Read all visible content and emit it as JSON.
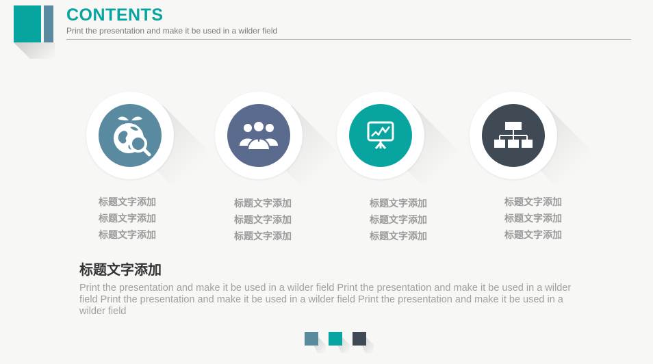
{
  "header": {
    "title": "CONTENTS",
    "subtitle": "Print the presentation and make it be used in a wilder field"
  },
  "colors": {
    "teal": "#08a5a0",
    "slate_blue": "#5a8aa0",
    "indigo": "#5a6b8e",
    "charcoal": "#3f4a55"
  },
  "items": [
    {
      "icon": "globe-search-icon",
      "lines": [
        "标题文字添加",
        "标题文字添加",
        "标题文字添加"
      ]
    },
    {
      "icon": "team-icon",
      "lines": [
        "标题文字添加",
        "标题文字添加",
        "标题文字添加"
      ]
    },
    {
      "icon": "presentation-chart-icon",
      "lines": [
        "标题文字添加",
        "标题文字添加",
        "标题文字添加"
      ]
    },
    {
      "icon": "org-chart-icon",
      "lines": [
        "标题文字添加",
        "标题文字添加",
        "标题文字添加"
      ]
    }
  ],
  "section": {
    "heading": "标题文字添加",
    "body": "Print the presentation and make it be used in a wilder field Print the presentation and make it be used in a wilder field Print the presentation and make it be used in a wilder field Print the presentation and make it be used in a wilder field"
  }
}
